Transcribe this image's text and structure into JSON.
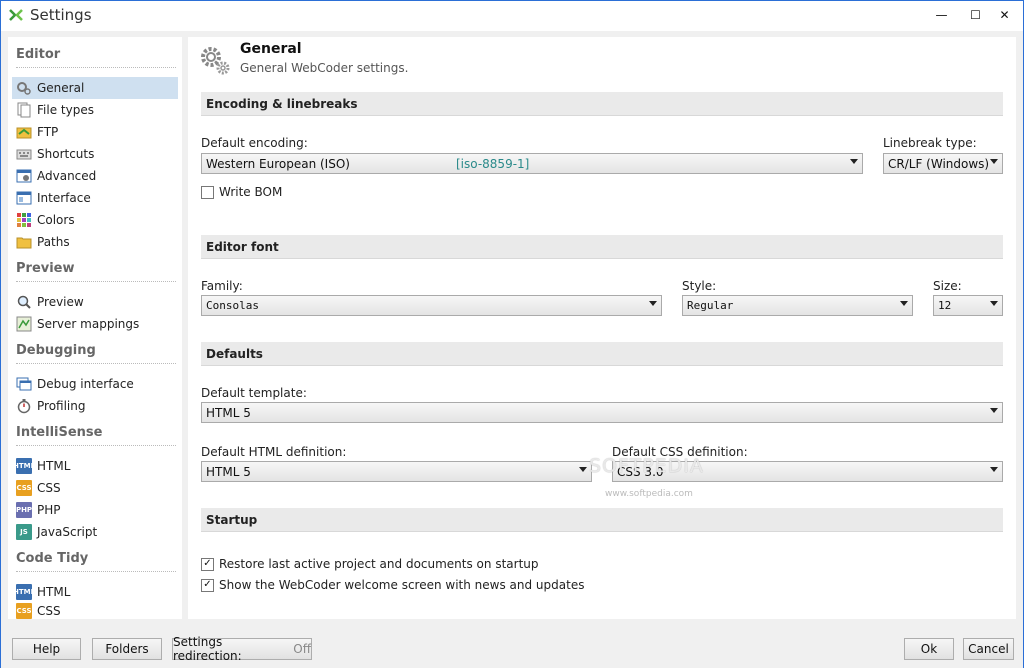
{
  "window": {
    "title": "Settings",
    "controls": {
      "minimize": "—",
      "maximize": "☐",
      "close": "✕"
    }
  },
  "sidebar": {
    "sections": [
      {
        "label": "Editor",
        "items": [
          {
            "label": "General",
            "icon": "gears-icon",
            "active": true
          },
          {
            "label": "File types",
            "icon": "file-types-icon"
          },
          {
            "label": "FTP",
            "icon": "ftp-icon"
          },
          {
            "label": "Shortcuts",
            "icon": "keyboard-icon"
          },
          {
            "label": "Advanced",
            "icon": "advanced-icon"
          },
          {
            "label": "Interface",
            "icon": "interface-icon"
          },
          {
            "label": "Colors",
            "icon": "colors-icon"
          },
          {
            "label": "Paths",
            "icon": "folder-icon"
          }
        ]
      },
      {
        "label": "Preview",
        "items": [
          {
            "label": "Preview",
            "icon": "magnifier-icon"
          },
          {
            "label": "Server mappings",
            "icon": "server-map-icon"
          }
        ]
      },
      {
        "label": "Debugging",
        "items": [
          {
            "label": "Debug interface",
            "icon": "debug-window-icon"
          },
          {
            "label": "Profiling",
            "icon": "stopwatch-icon"
          }
        ]
      },
      {
        "label": "IntelliSense",
        "items": [
          {
            "label": "HTML",
            "icon": "html-icon",
            "badge": "HTML"
          },
          {
            "label": "CSS",
            "icon": "css-icon",
            "badge": "CSS"
          },
          {
            "label": "PHP",
            "icon": "php-icon",
            "badge": "PHP"
          },
          {
            "label": "JavaScript",
            "icon": "javascript-icon",
            "badge": "JS"
          }
        ]
      },
      {
        "label": "Code Tidy",
        "items": [
          {
            "label": "HTML",
            "icon": "html-icon",
            "badge": "HTML"
          },
          {
            "label": "CSS",
            "icon": "css-icon",
            "badge": "CSS"
          }
        ]
      }
    ]
  },
  "page": {
    "title": "General",
    "subtitle": "General WebCoder settings."
  },
  "encoding": {
    "section_title": "Encoding & linebreaks",
    "default_encoding_label": "Default encoding:",
    "default_encoding_value": "Western European (ISO)",
    "default_encoding_code": "[iso-8859-1]",
    "linebreak_label": "Linebreak type:",
    "linebreak_value": "CR/LF (Windows)",
    "write_bom_label": "Write BOM",
    "write_bom_checked": false
  },
  "font": {
    "section_title": "Editor font",
    "family_label": "Family:",
    "family_value": "Consolas",
    "style_label": "Style:",
    "style_value": "Regular",
    "size_label": "Size:",
    "size_value": "12"
  },
  "defaults": {
    "section_title": "Defaults",
    "template_label": "Default template:",
    "template_value": "HTML 5",
    "html_def_label": "Default HTML definition:",
    "html_def_value": "HTML 5",
    "css_def_label": "Default CSS definition:",
    "css_def_value": "CSS 3.0"
  },
  "startup": {
    "section_title": "Startup",
    "restore_label": "Restore last active project and documents on startup",
    "restore_checked": true,
    "welcome_label": "Show the WebCoder welcome screen with news and updates",
    "welcome_checked": true
  },
  "footer": {
    "help": "Help",
    "folders": "Folders",
    "redirection_label": "Settings redirection:",
    "redirection_state": "Off",
    "ok": "Ok",
    "cancel": "Cancel"
  },
  "watermark": {
    "text": "SOFTPEDIA",
    "url": "www.softpedia.com"
  }
}
